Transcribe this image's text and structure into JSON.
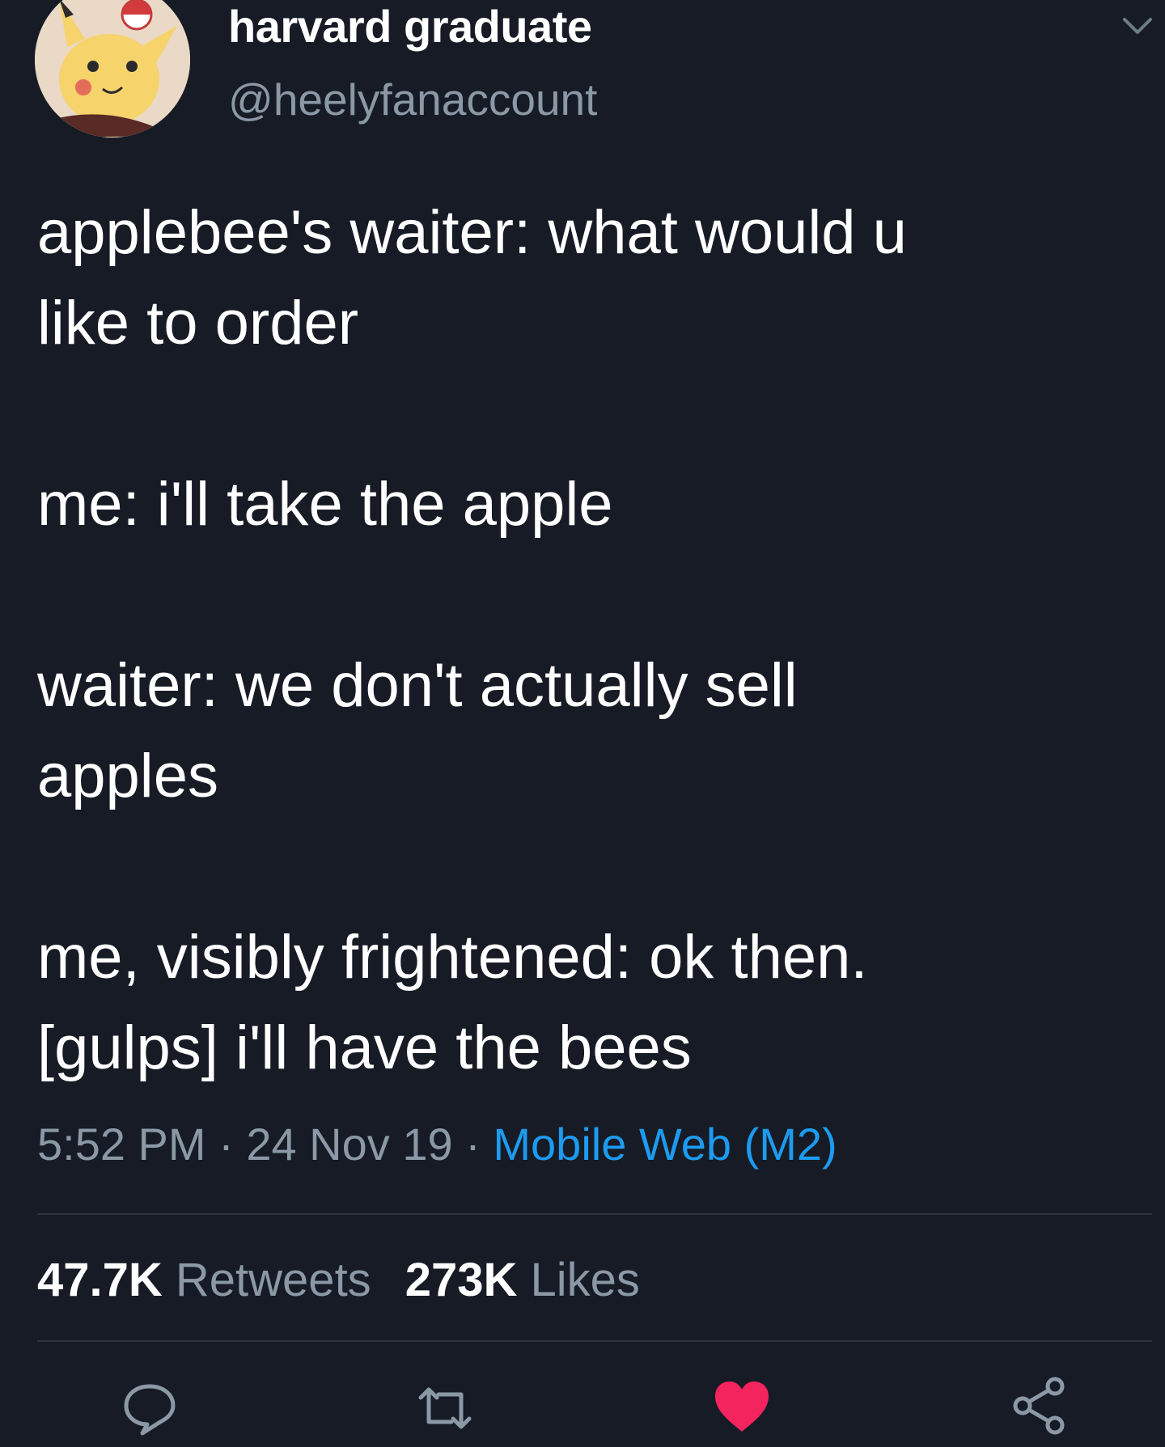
{
  "user": {
    "display_name": "harvard graduate",
    "handle": "@heelyfanaccount",
    "avatar_icon": "pikachu-avatar"
  },
  "tweet": {
    "paragraphs": [
      "applebee's waiter: what would u\nlike to order",
      "me: i'll take the apple",
      "waiter: we don't actually sell\napples",
      "me, visibly frightened: ok then.\n[gulps] i'll have the bees"
    ]
  },
  "meta": {
    "time": "5:52 PM",
    "sep1": " · ",
    "date": "24 Nov 19",
    "sep2": " · ",
    "source": "Mobile Web (M2)"
  },
  "stats": {
    "retweets_count": "47.7K",
    "retweets_label": "Retweets",
    "likes_count": "273K",
    "likes_label": "Likes"
  },
  "actions": {
    "reply_icon": "reply-icon",
    "retweet_icon": "retweet-icon",
    "like_icon": "heart-icon",
    "share_icon": "share-icon"
  },
  "colors": {
    "background": "#161b25",
    "secondary_text": "#8b98a5",
    "link": "#1d9bf0",
    "like": "#f4245e"
  }
}
